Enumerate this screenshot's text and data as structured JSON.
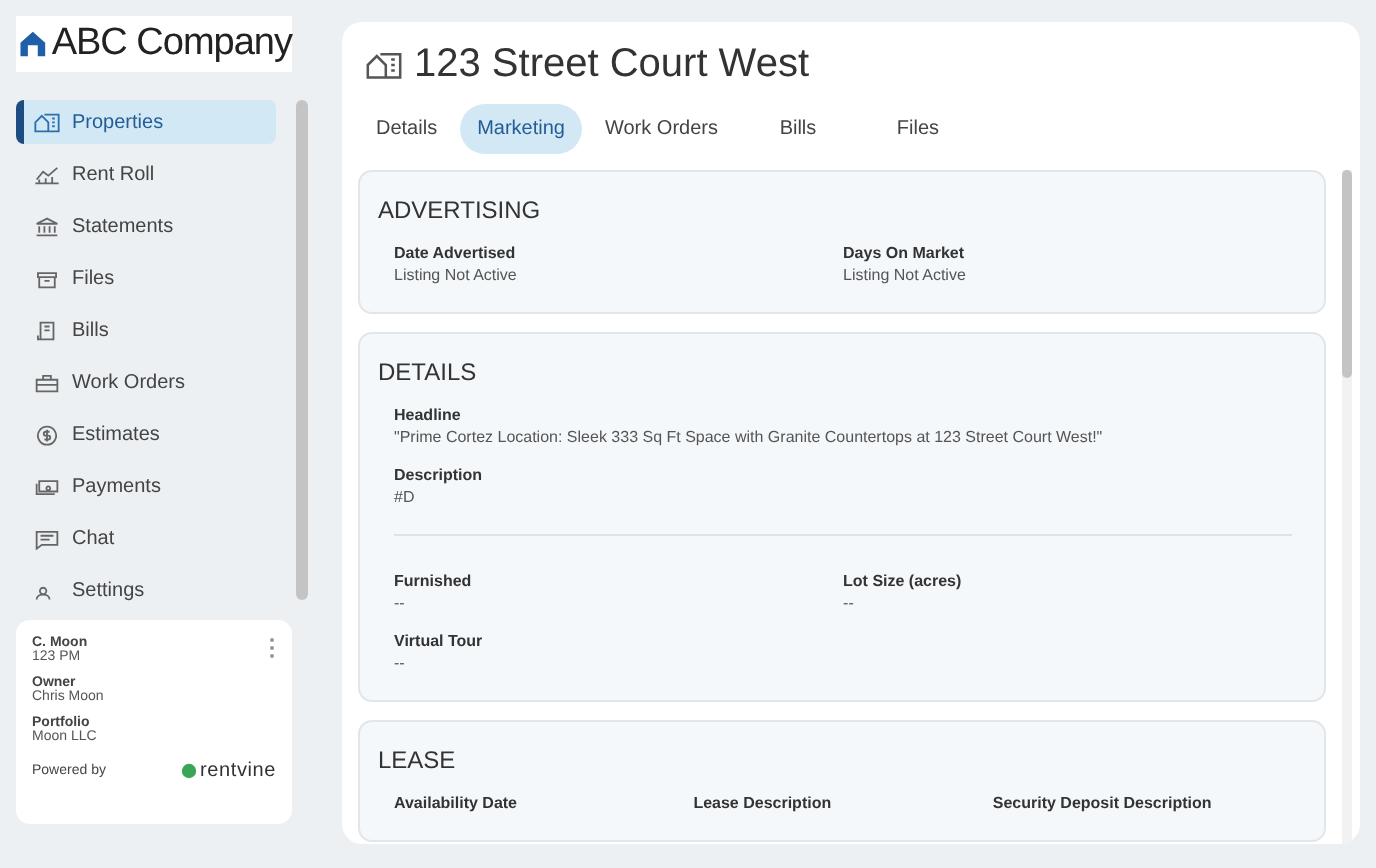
{
  "logo": {
    "name": "ABC Company"
  },
  "sidebar": {
    "items": [
      {
        "label": "Properties",
        "selected": true
      },
      {
        "label": "Rent Roll",
        "selected": false
      },
      {
        "label": "Statements",
        "selected": false
      },
      {
        "label": "Files",
        "selected": false
      },
      {
        "label": "Bills",
        "selected": false
      },
      {
        "label": "Work Orders",
        "selected": false
      },
      {
        "label": "Estimates",
        "selected": false
      },
      {
        "label": "Payments",
        "selected": false
      },
      {
        "label": "Chat",
        "selected": false
      },
      {
        "label": "Settings",
        "selected": false
      }
    ]
  },
  "user_card": {
    "name": "C. Moon",
    "code": "123 PM",
    "fields": [
      {
        "label": "Owner",
        "value": "Chris Moon"
      },
      {
        "label": "Portfolio",
        "value": "Moon LLC"
      }
    ],
    "powered_by": "Powered by",
    "brand": "rentvine"
  },
  "page": {
    "title": "123 Street Court West",
    "tabs": [
      {
        "label": "Details",
        "selected": false
      },
      {
        "label": "Marketing",
        "selected": true
      },
      {
        "label": "Work Orders",
        "selected": false
      },
      {
        "label": "Bills",
        "selected": false
      },
      {
        "label": "Files",
        "selected": false
      }
    ],
    "sections": [
      {
        "title": "ADVERTISING",
        "groups": [
          [
            {
              "label": "Date Advertised",
              "value": "Listing Not Active"
            },
            {
              "label": "Days On Market",
              "value": "Listing Not Active"
            }
          ]
        ]
      },
      {
        "title": "DETAILS",
        "groups": [
          [
            {
              "label": "Headline",
              "value": "\"Prime Cortez Location: Sleek 333 Sq Ft Space with Granite Countertops at 123 Street Court West!\""
            },
            {
              "label": "Description",
              "value": "#D"
            }
          ],
          [
            {
              "label": "Furnished",
              "value": "--"
            },
            {
              "label": "Lot Size (acres)",
              "value": "--"
            },
            {
              "label": "Virtual Tour",
              "value": "--"
            }
          ]
        ]
      },
      {
        "title": "LEASE",
        "groups": [
          [
            {
              "label": "Availability Date"
            },
            {
              "label": "Lease Description"
            },
            {
              "label": "Security Deposit Description"
            }
          ]
        ]
      }
    ]
  }
}
